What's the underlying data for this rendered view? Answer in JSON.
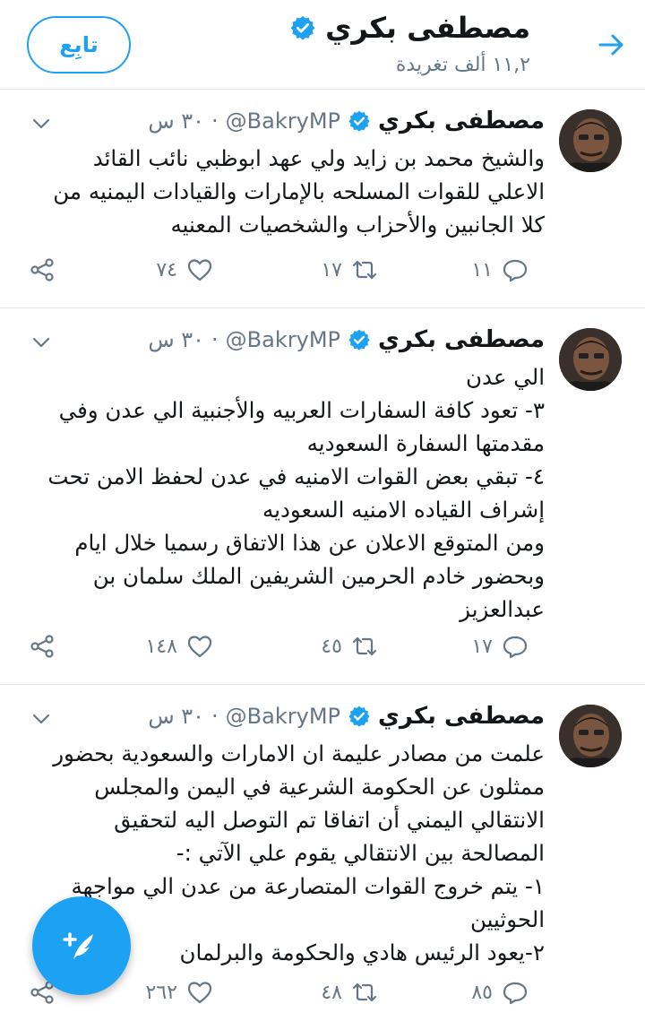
{
  "header": {
    "name": "مصطفى بكري",
    "tweet_count": "١١,٢ ألف تغريدة",
    "follow_label": "تابِع"
  },
  "tweets": [
    {
      "name": "مصطفى بكري",
      "handle": "@BakryMP",
      "time": "٣٠ س",
      "lines": [
        "والشيخ محمد بن زايد ولي عهد ابوظبي نائب القائد",
        "الاعلي للقوات المسلحه بالإمارات والقيادات اليمنيه من",
        "كلا الجانبين والأحزاب والشخصيات المعنيه"
      ],
      "replies": "١١",
      "retweets": "١٧",
      "likes": "٧٤"
    },
    {
      "name": "مصطفى بكري",
      "handle": "@BakryMP",
      "time": "٣٠ س",
      "lines": [
        "الي عدن",
        "٣- تعود كافة السفارات العربيه والأجنبية الي عدن وفي",
        "مقدمتها السفارة السعوديه",
        "٤- تبقي بعض القوات الامنيه في عدن لحفظ الامن تحت",
        "إشراف القياده الامنيه السعوديه",
        "ومن المتوقع الاعلان عن هذا الاتفاق رسميا خلال ايام",
        "وبحضور خادم الحرمين الشريفين الملك سلمان بن",
        "عبدالعزيز"
      ],
      "replies": "١٧",
      "retweets": "٤٥",
      "likes": "١٤٨"
    },
    {
      "name": "مصطفى بكري",
      "handle": "@BakryMP",
      "time": "٣٠ س",
      "lines": [
        "علمت من مصادر عليمة ان الامارات والسعودية بحضور",
        "ممثلون عن الحكومة الشرعية في اليمن والمجلس",
        "الانتقالي اليمني أن اتفاقا تم التوصل اليه لتحقيق",
        "المصالحة بين الانتقالي يقوم علي الآتي :-",
        "١- يتم خروج القوات المتصارعة من عدن الي مواجهة",
        "الحوثيين",
        "٢-يعود الرئيس هادي والحكومة والبرلمان"
      ],
      "replies": "٨٥",
      "retweets": "٤٨",
      "likes": "٢٦٢"
    }
  ],
  "colors": {
    "accent": "#1da1f2",
    "secondary_text": "#657786",
    "divider": "#e1e8ed"
  },
  "icons": [
    "back-arrow-icon",
    "verified-badge-icon",
    "chevron-down-icon",
    "reply-icon",
    "retweet-icon",
    "like-icon",
    "share-icon",
    "compose-tweet-icon"
  ]
}
